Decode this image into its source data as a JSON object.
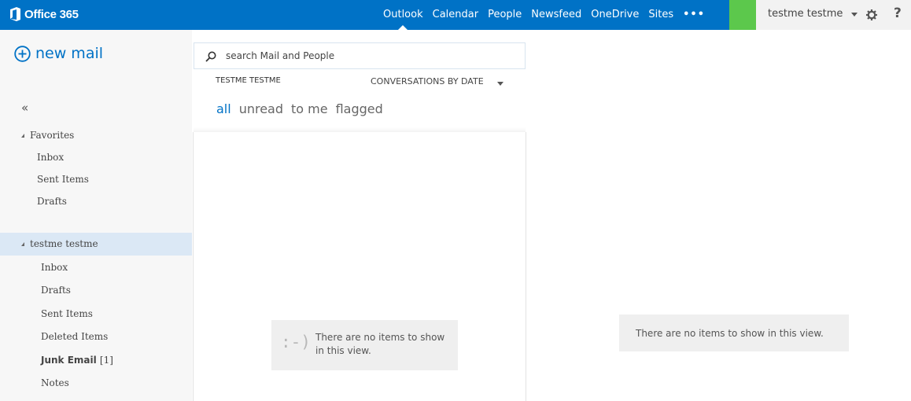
{
  "topbar": {
    "brand": "Office 365",
    "nav": [
      {
        "label": "Outlook",
        "active": true
      },
      {
        "label": "Calendar"
      },
      {
        "label": "People"
      },
      {
        "label": "Newsfeed"
      },
      {
        "label": "OneDrive"
      },
      {
        "label": "Sites"
      }
    ],
    "more": "•••",
    "user": "testme testme",
    "help": "?"
  },
  "sidebar": {
    "new_mail": "new mail",
    "collapse": "«",
    "favorites_label": "Favorites",
    "favorites": [
      "Inbox",
      "Sent Items",
      "Drafts"
    ],
    "account_label": "testme testme",
    "folders": [
      {
        "label": "Inbox"
      },
      {
        "label": "Drafts"
      },
      {
        "label": "Sent Items"
      },
      {
        "label": "Deleted Items"
      },
      {
        "label": "Junk Email",
        "count": "[1]",
        "bold": true
      },
      {
        "label": "Notes"
      }
    ]
  },
  "mail_list": {
    "search_placeholder": "search Mail and People",
    "account_header": "TESTME TESTME",
    "sort_label": "CONVERSATIONS BY DATE",
    "filters": [
      {
        "label": "all",
        "active": true
      },
      {
        "label": "unread"
      },
      {
        "label": "to me"
      },
      {
        "label": "flagged"
      }
    ],
    "empty_icon": ":-)",
    "empty_text": "There are no items to show in this view."
  },
  "reading_pane": {
    "empty_text": "There are no items to show in this view."
  },
  "colors": {
    "brand_blue": "#0072c6",
    "status_green": "#5cc84c",
    "selected_bg": "#dbe8f5"
  }
}
